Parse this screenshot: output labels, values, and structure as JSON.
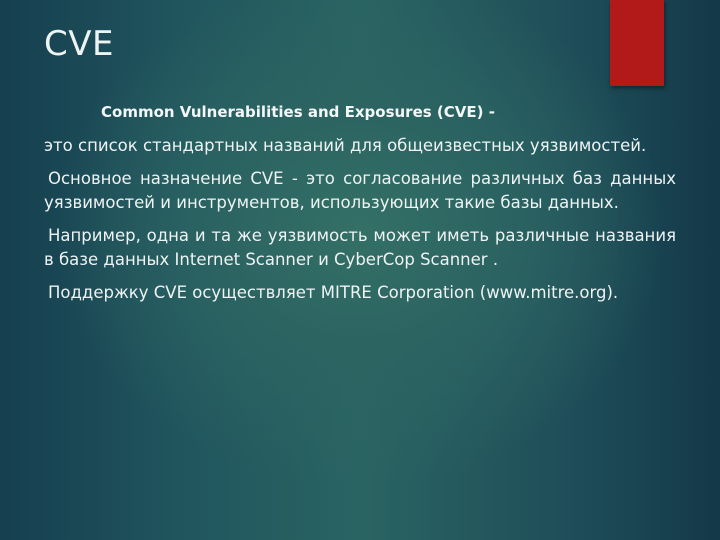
{
  "slide": {
    "title": "CVE",
    "subtitle": "Common Vulnerabilities and Exposures (CVE) -",
    "paragraphs": [
      "это список стандартных названий для общеизвестных уязвимостей.",
      "Основное назначение CVE - это согласование различных баз данных уязвимостей и инструментов, использующих такие базы данных.",
      "Например, одна и та же уязвимость может иметь различные названия в базе данных Internet Scanner и CyberCop Scanner .",
      "Поддержку CVE осуществляет MITRE Corporation (www.mitre.org)."
    ],
    "colors": {
      "accent": "#b21a1a",
      "background": "#2a6462",
      "text": "#eef3f3"
    }
  }
}
